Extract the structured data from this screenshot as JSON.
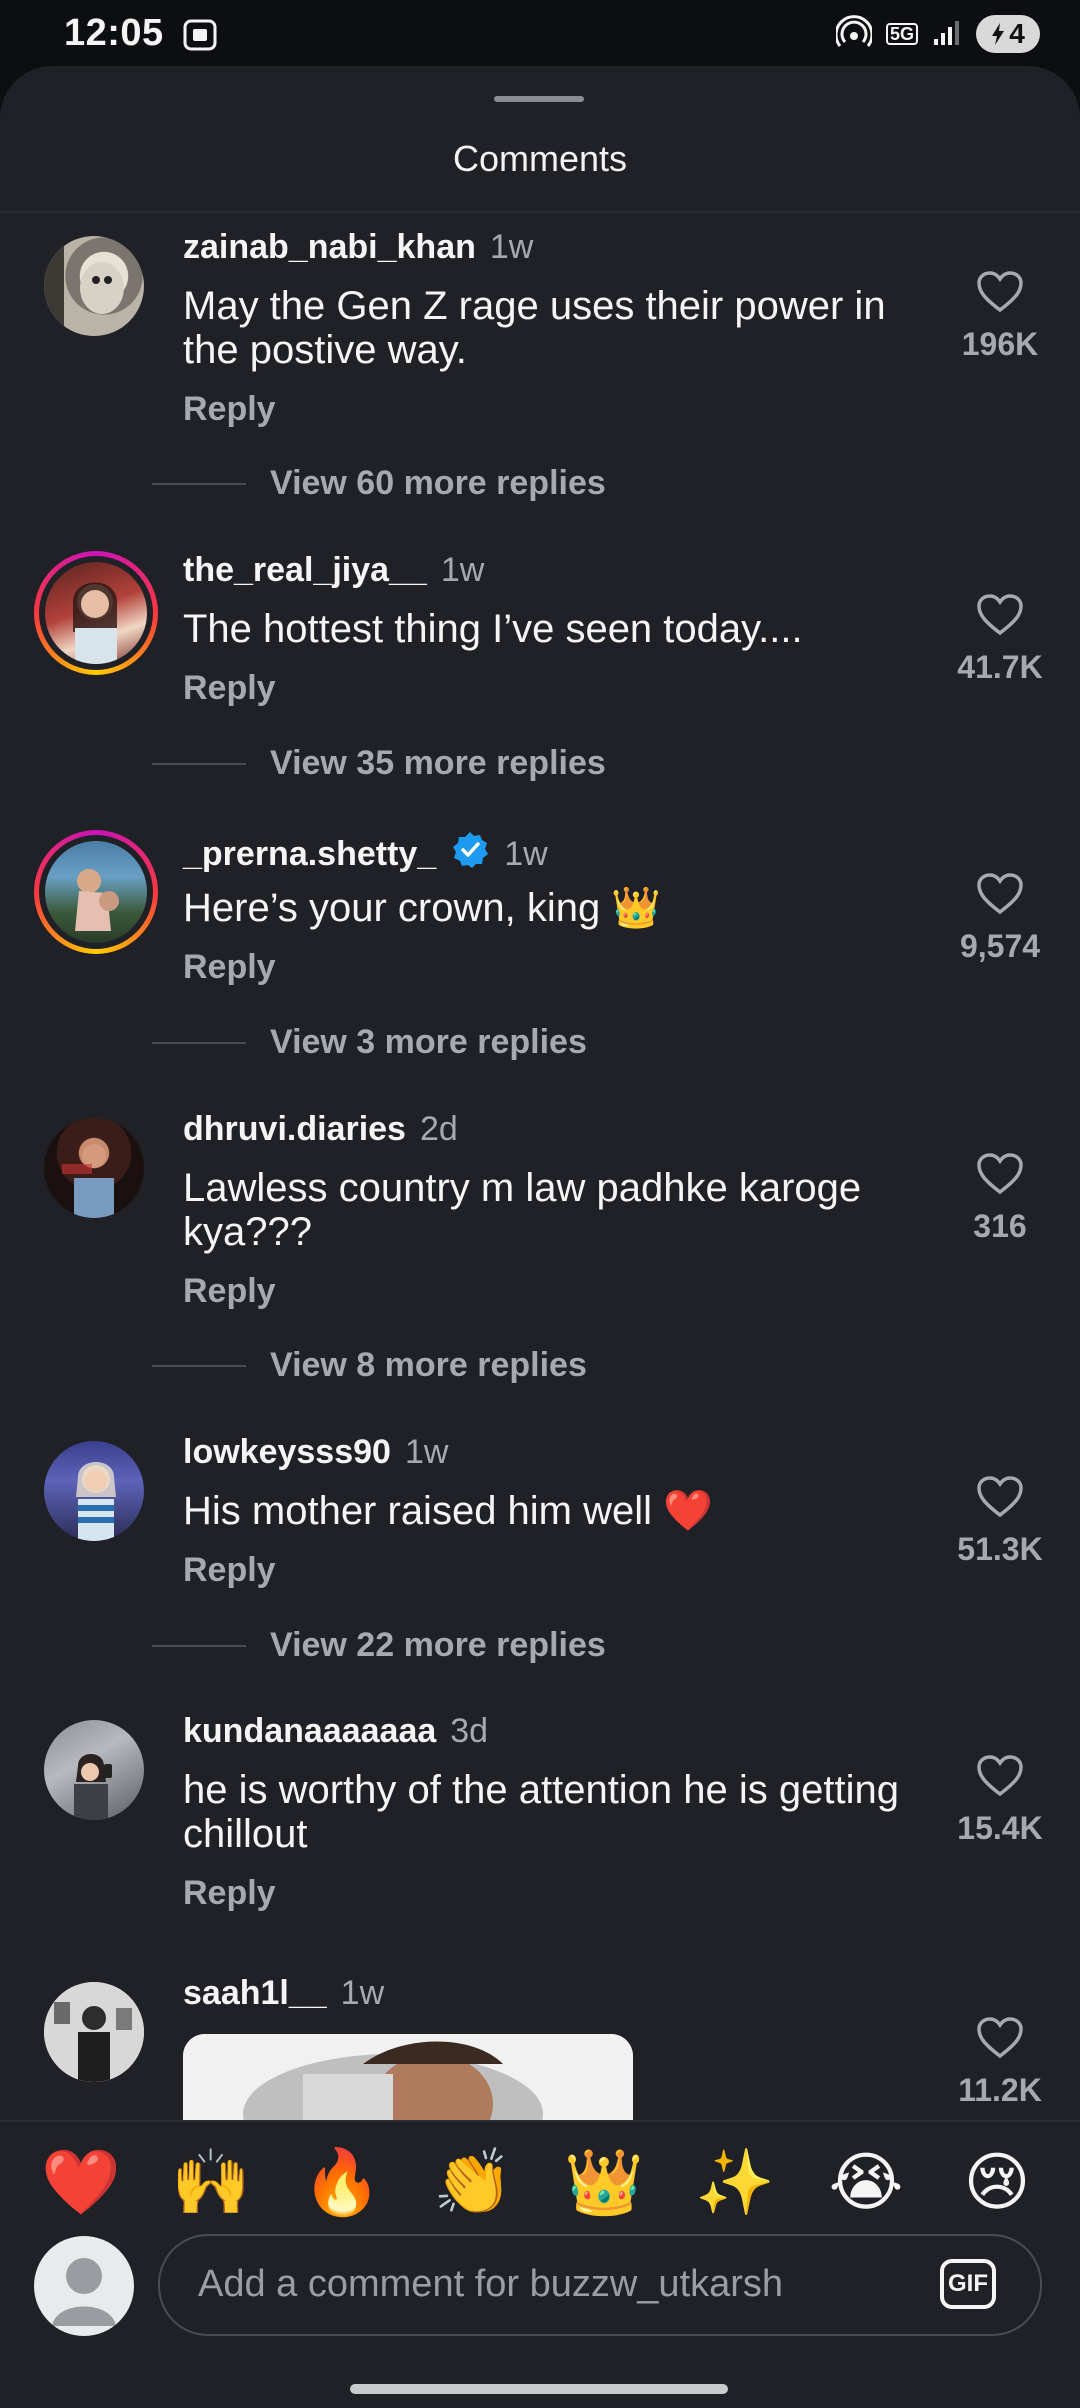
{
  "status": {
    "time": "12:05",
    "network": "5G",
    "battery": "4"
  },
  "sheet": {
    "title": "Comments"
  },
  "comments": [
    {
      "user": "zainab_nabi_khan",
      "time": "1w",
      "text": "May the Gen Z rage uses their power in the postive way.",
      "reply": "Reply",
      "likes": "196K",
      "more": "View 60 more replies"
    },
    {
      "user": "the_real_jiya__",
      "time": "1w",
      "text": "The hottest thing I’ve seen today....",
      "reply": "Reply",
      "likes": "41.7K",
      "more": "View 35 more replies"
    },
    {
      "user": "_prerna.shetty_",
      "time": "1w",
      "text": "Here’s your crown, king 👑",
      "reply": "Reply",
      "likes": "9,574",
      "more": "View 3 more replies",
      "verified": true
    },
    {
      "user": "dhruvi.diaries",
      "time": "2d",
      "text": "Lawless country m law padhke karoge kya???",
      "reply": "Reply",
      "likes": "316",
      "more": "View 8 more replies"
    },
    {
      "user": "lowkeysss90",
      "time": "1w",
      "text": "His mother raised him well ❤️",
      "reply": "Reply",
      "likes": "51.3K",
      "more": "View 22 more replies"
    },
    {
      "user": "kundanaaaaaaa",
      "time": "3d",
      "text": "he is worthy of the attention he is getting chillout",
      "reply": "Reply",
      "likes": "15.4K"
    },
    {
      "user": "saah1l__",
      "time": "1w",
      "likes": "11.2K"
    }
  ],
  "emoji_bar": [
    "❤️",
    "🙌",
    "🔥",
    "👏",
    "👑",
    "✨",
    "😭",
    "😢"
  ],
  "composer": {
    "placeholder": "Add a comment for buzzw_utkarsh",
    "gif_label": "GIF"
  },
  "colors": {
    "background": "#1f2126",
    "secondary_text": "#a7a9ae",
    "verified": "#1d9bf0"
  }
}
